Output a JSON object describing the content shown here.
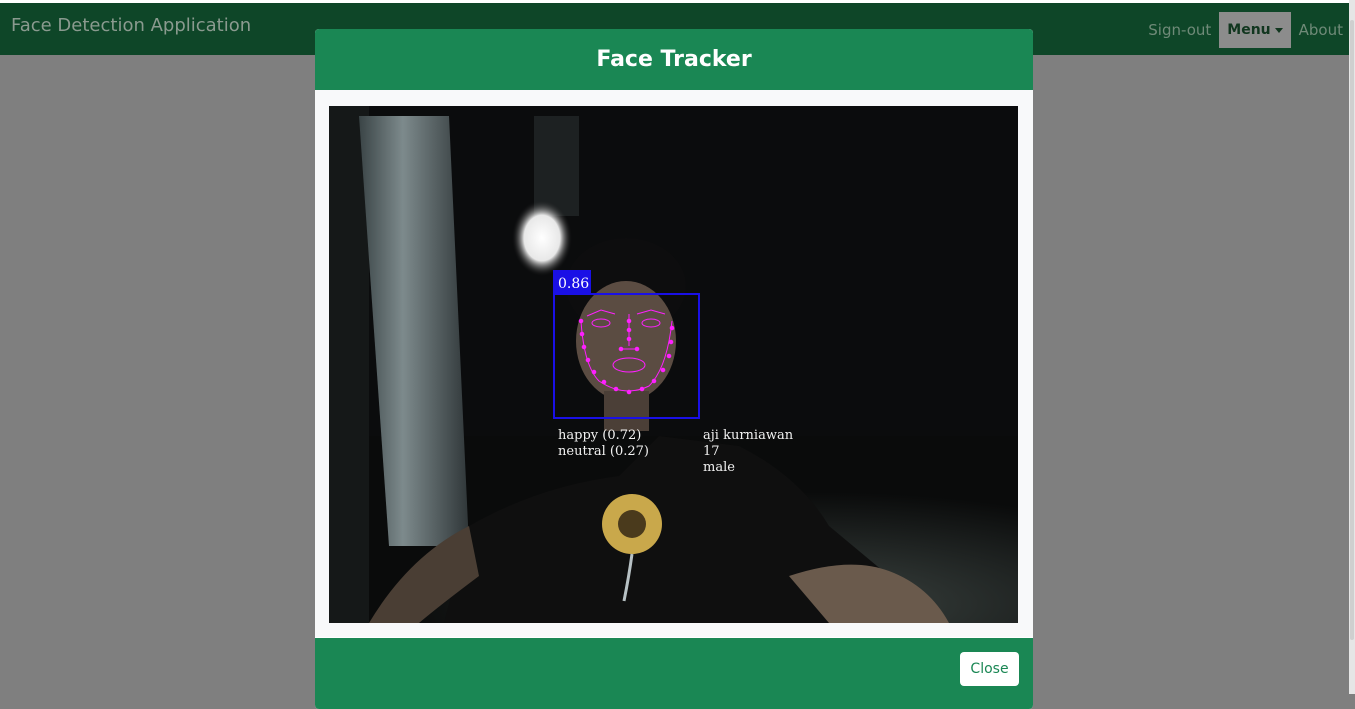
{
  "navbar": {
    "brand": "Face Detection Application",
    "signout_label": "Sign-out",
    "menu_label": "Menu",
    "about_label": "About"
  },
  "modal": {
    "title": "Face Tracker",
    "close_label": "Close"
  },
  "detection": {
    "score": "0.86",
    "expressions": [
      "happy (0.72)",
      "neutral (0.27)"
    ],
    "name": "aji kurniawan",
    "age": "17",
    "gender": "male"
  },
  "colors": {
    "header_green": "#1a8754",
    "navbar_dark_green": "#0e4628",
    "box_blue": "#1a10e6",
    "landmark_magenta": "#ff20ff"
  },
  "icons": {
    "menu_caret": "caret-down"
  }
}
